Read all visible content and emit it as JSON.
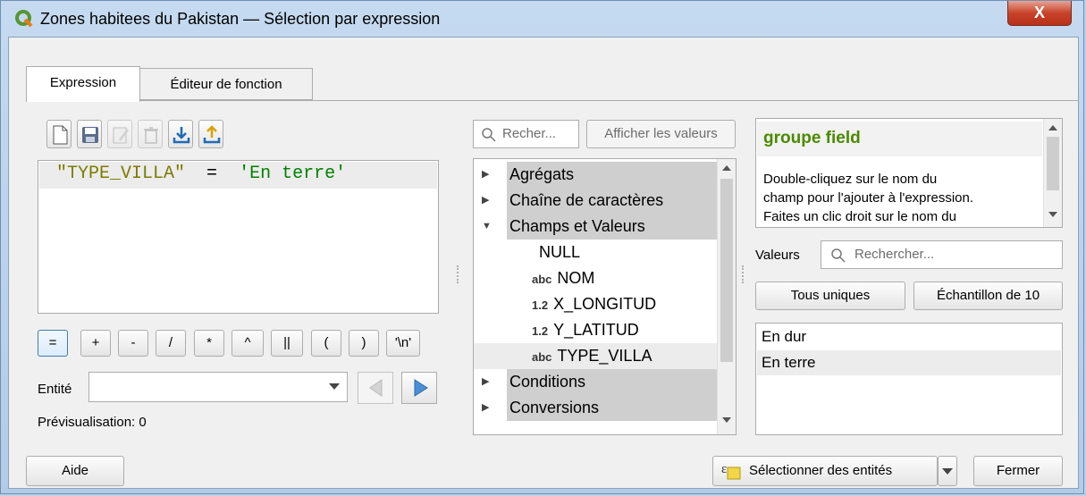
{
  "window": {
    "title": "Zones habitees du Pakistan — Sélection par expression",
    "close_label": "X"
  },
  "tabs": [
    {
      "label": "Expression"
    },
    {
      "label": "Éditeur de fonction"
    }
  ],
  "expression": {
    "field": "\"TYPE_VILLA\"",
    "operator": "=",
    "literal": "'En terre'"
  },
  "operators": [
    "=",
    "+",
    "-",
    "/",
    "*",
    "^",
    "||",
    "(",
    ")",
    "'\\n'"
  ],
  "entity": {
    "label": "Entité",
    "value": ""
  },
  "preview": {
    "label": "Prévisualisation:",
    "value": "0"
  },
  "search": {
    "placeholder": "Recher...",
    "show_values": "Afficher les valeurs"
  },
  "tree": [
    {
      "label": "Agrégats",
      "type": "group",
      "expanded": false
    },
    {
      "label": "Chaîne de caractères",
      "type": "group",
      "expanded": false
    },
    {
      "label": "Champs et Valeurs",
      "type": "group",
      "expanded": true
    },
    {
      "label": "NULL",
      "type": "item",
      "tag": ""
    },
    {
      "label": "NOM",
      "type": "item",
      "tag": "abc"
    },
    {
      "label": "X_LONGITUD",
      "type": "item",
      "tag": "1.2"
    },
    {
      "label": "Y_LATITUD",
      "type": "item",
      "tag": "1.2"
    },
    {
      "label": "TYPE_VILLA",
      "type": "item",
      "tag": "abc"
    },
    {
      "label": "Conditions",
      "type": "group",
      "expanded": false
    },
    {
      "label": "Conversions",
      "type": "group",
      "expanded": false
    }
  ],
  "help": {
    "title": "groupe field",
    "lines": [
      "Double-cliquez sur le nom du",
      "champ pour l'ajouter à l'expression.",
      "Faites un clic droit sur le nom du"
    ]
  },
  "values": {
    "label": "Valeurs",
    "search_placeholder": "Rechercher...",
    "all_unique": "Tous uniques",
    "sample": "Échantillon de 10",
    "items": [
      "En dur",
      "En terre"
    ]
  },
  "footer": {
    "help": "Aide",
    "select": "Sélectionner des entités",
    "close": "Fermer"
  },
  "colors": {
    "field": "#7a7a00",
    "operator": "#000",
    "literal": "#008000",
    "help_title": "#4a8a00"
  }
}
